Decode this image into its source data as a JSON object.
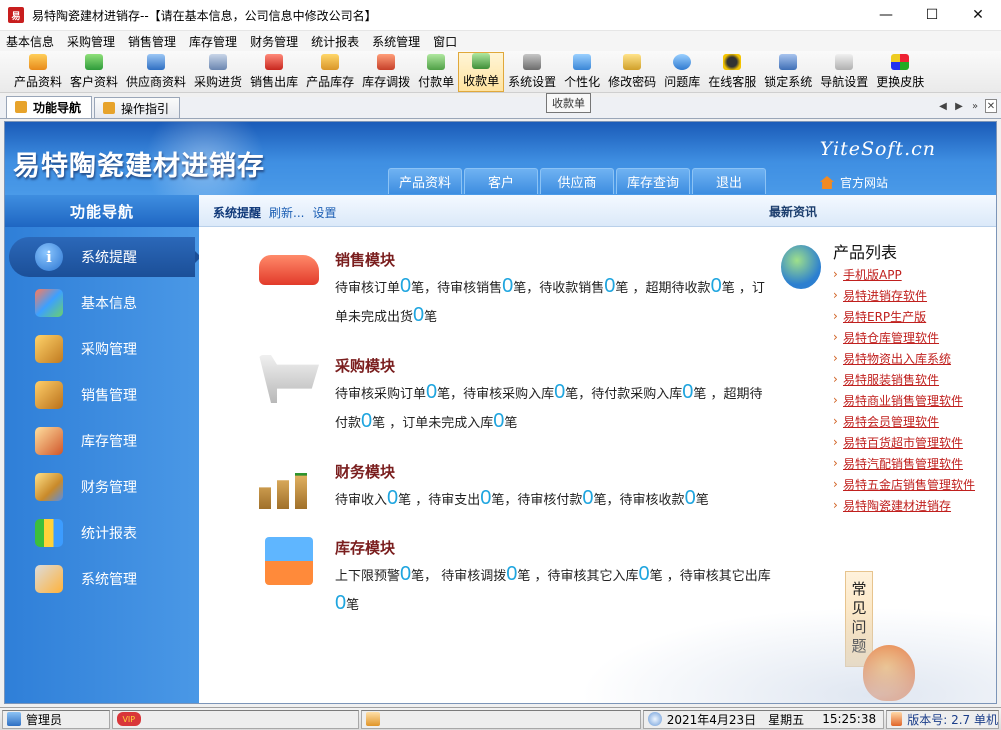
{
  "window": {
    "title": "易特陶瓷建材进销存--【请在基本信息，公司信息中修改公司名】",
    "icon_text": "易",
    "buttons": [
      "—",
      "☐",
      "✕"
    ]
  },
  "menu": [
    "基本信息",
    "采购管理",
    "销售管理",
    "库存管理",
    "财务管理",
    "统计报表",
    "系统管理",
    "窗口"
  ],
  "toolbar": {
    "buttons": [
      "产品资料",
      "客户资料",
      "供应商资料",
      "采购进货",
      "销售出库",
      "产品库存",
      "库存调拨",
      "付款单",
      "收款单",
      "系统设置",
      "个性化",
      "修改密码",
      "问题库",
      "在线客服",
      "锁定系统",
      "导航设置",
      "更换皮肤"
    ],
    "active": "收款单",
    "tooltip": "收款单"
  },
  "tabs": [
    "功能导航",
    "操作指引"
  ],
  "banner": {
    "brand": "易特陶瓷建材进销存",
    "brand_en": "YiteSoft.cn",
    "site_link": "官方网站",
    "nav": [
      "产品资料",
      "客户",
      "供应商",
      "库存查询",
      "退出"
    ]
  },
  "sidebar": {
    "title": "功能导航",
    "items": [
      "系统提醒",
      "基本信息",
      "采购管理",
      "销售管理",
      "库存管理",
      "财务管理",
      "统计报表",
      "系统管理"
    ]
  },
  "subbar": {
    "section": "系统提醒",
    "refresh": "刷新...",
    "settings": "设置",
    "news": "最新资讯"
  },
  "modules": {
    "sales": {
      "title": "销售模块",
      "t1": "待审核订单",
      "v1": "0",
      "t2": "笔，待审核销售",
      "v2": "0",
      "t3": "笔，待收款销售",
      "v3": "0",
      "t4": "笔 ，超期待收款",
      "v4": "0",
      "t5": "笔 ，订单未完成出货",
      "v5": "0",
      "t6": "笔"
    },
    "purchase": {
      "title": "采购模块",
      "t1": "待审核采购订单",
      "v1": "0",
      "t2": "笔，待审核采购入库",
      "v2": "0",
      "t3": "笔，待付款采购入库",
      "v3": "0",
      "t4": "笔 ，超期待付款",
      "v4": "0",
      "t5": "笔 ，订单未完成入库",
      "v5": "0",
      "t6": "笔"
    },
    "finance": {
      "title": "财务模块",
      "t1": "待审收入",
      "v1": "0",
      "t2": "笔 ，待审支出",
      "v2": "0",
      "t3": "笔，待审核付款",
      "v3": "0",
      "t4": "笔，待审核收款",
      "v4": "0",
      "t5": "笔"
    },
    "inventory": {
      "title": "库存模块",
      "t1": "上下限预警",
      "v1": "0",
      "t2": "笔， 待审核调拨",
      "v2": "0",
      "t3": "笔 ，待审核其它入库",
      "v3": "0",
      "t4": "笔 ，待审核其它出库",
      "v4": "0",
      "t5": "笔"
    }
  },
  "products": {
    "title": "产品列表",
    "items": [
      "手机版APP",
      "易特进销存软件",
      "易特ERP生产版",
      "易特仓库管理软件",
      "易特物资出入库系统",
      "易特服装销售软件",
      "易特商业销售管理软件",
      "易特会员管理软件",
      "易特百货超市管理软件",
      "易特汽配销售管理软件",
      "易特五金店销售管理软件",
      "易特陶瓷建材进销存"
    ]
  },
  "faq": "常见问题",
  "statusbar": {
    "user": "管理员",
    "vip": "VIP",
    "date": "2021年4月23日",
    "weekday": "星期五",
    "time": "15:25:38",
    "version": "版本号: 2.7 单机"
  }
}
